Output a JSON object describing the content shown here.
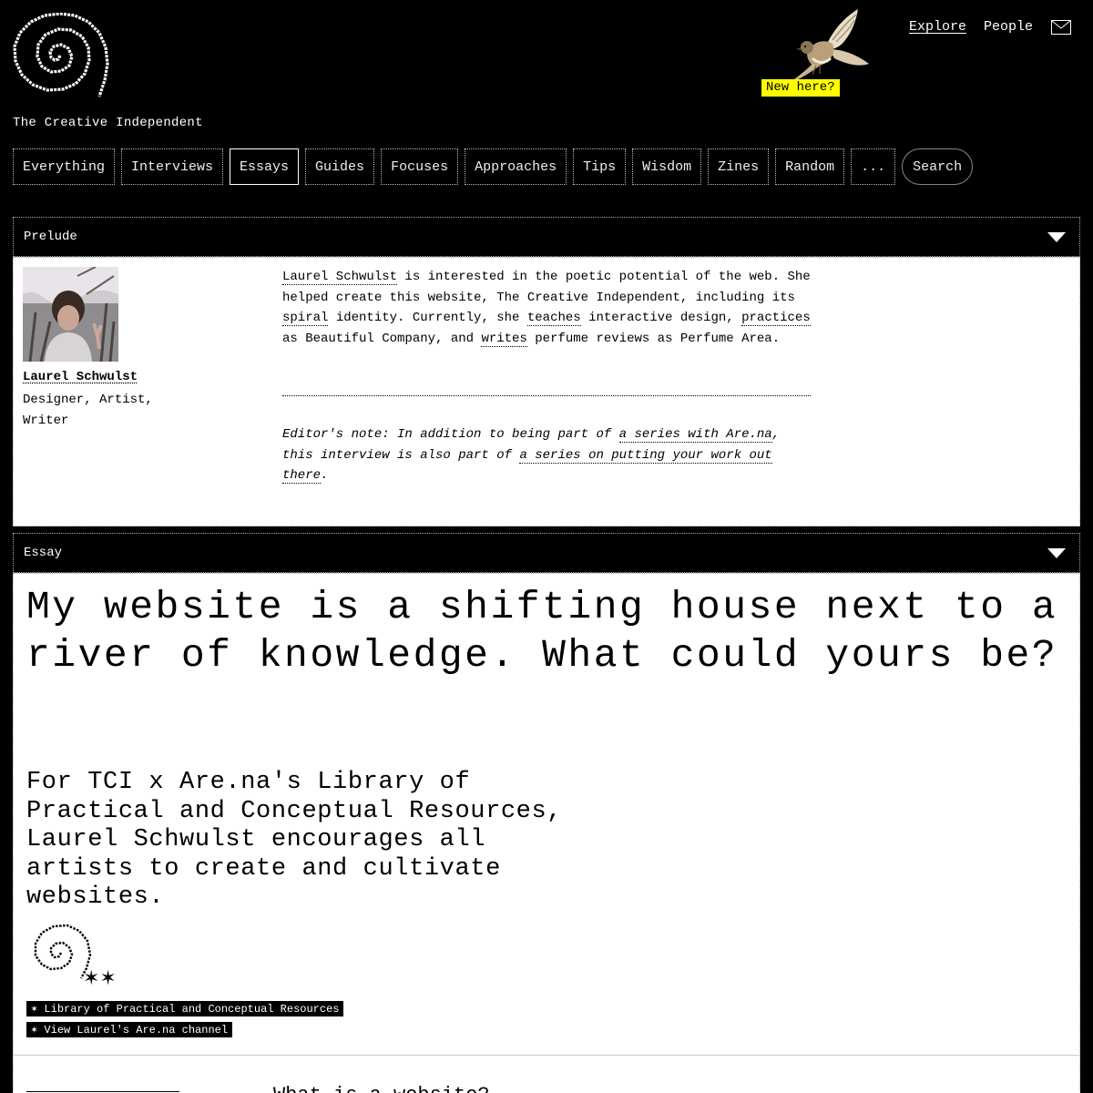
{
  "site": {
    "name": "The Creative Independent",
    "new_here": "New here?"
  },
  "topnav": {
    "explore": "Explore",
    "people": "People"
  },
  "filters": [
    {
      "label": "Everything"
    },
    {
      "label": "Interviews"
    },
    {
      "label": "Essays",
      "active": true
    },
    {
      "label": "Guides"
    },
    {
      "label": "Focuses"
    },
    {
      "label": "Approaches"
    },
    {
      "label": "Tips"
    },
    {
      "label": "Wisdom"
    },
    {
      "label": "Zines"
    },
    {
      "label": "Random"
    },
    {
      "label": "..."
    }
  ],
  "search_label": "Search",
  "prelude": {
    "heading": "Prelude",
    "author_name": "Laurel Schwulst",
    "author_role": "Designer, Artist, Writer",
    "bio": {
      "name_link": "Laurel Schwulst",
      "t1": " is interested in the poetic potential of the web. She helped create this website, The Creative Independent, including its ",
      "spiral": "spiral",
      "t2": " identity. Currently, she ",
      "teaches": "teaches",
      "t3": " interactive design, ",
      "practices": "practices",
      "t4": " as Beautiful Company, and ",
      "writes": "writes",
      "t5": " perfume reviews as Perfume Area."
    },
    "note": {
      "t1": "Editor's note: In addition to being part of ",
      "link1": "a series with Are.na",
      "t2": ", this interview is also part of ",
      "link2": "a series on putting your work out there",
      "t3": "."
    }
  },
  "essay": {
    "heading": "Essay",
    "title": "My website is a shifting house next to a river of knowledge. What could yours be?",
    "dek": "For TCI x Are.na's Library of Practical and Conceptual Resources, Laurel Schwulst encourages all artists to create and cultivate websites.",
    "tag1": "✶ Library of Practical and Conceptual Resources",
    "tag2": "✶ View Laurel's Are.na channel",
    "next_question": "What is a website?"
  }
}
